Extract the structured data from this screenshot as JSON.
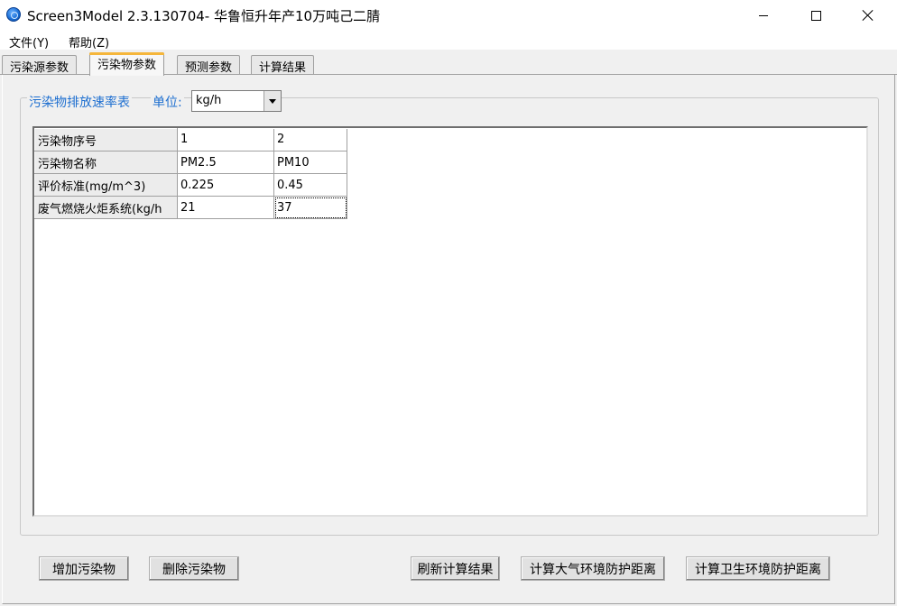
{
  "window": {
    "title": "Screen3Model 2.3.130704- 华鲁恒升年产10万吨己二腈",
    "icon": "app-globe-icon"
  },
  "menu": {
    "file": "文件(Y)",
    "help": "帮助(Z)"
  },
  "tabs": [
    {
      "label": "污染源参数",
      "active": false
    },
    {
      "label": "污染物参数",
      "active": true
    },
    {
      "label": "预测参数",
      "active": false
    },
    {
      "label": "计算结果",
      "active": false
    }
  ],
  "group": {
    "title": "污染物排放速率表",
    "unit_label": "单位:",
    "unit_value": "kg/h"
  },
  "grid": {
    "rows": [
      {
        "header": "污染物序号",
        "cells": [
          "1",
          "2"
        ]
      },
      {
        "header": "污染物名称",
        "cells": [
          "PM2.5",
          "PM10"
        ]
      },
      {
        "header": "评价标准(mg/m^3)",
        "cells": [
          "0.225",
          "0.45"
        ]
      },
      {
        "header": "废气燃烧火炬系统(kg/h",
        "cells": [
          "21",
          "37"
        ]
      }
    ]
  },
  "buttons": {
    "add": "增加污染物",
    "delete": "删除污染物",
    "refresh": "刷新计算结果",
    "atmos": "计算大气环境防护距离",
    "health": "计算卫生环境防护距离"
  },
  "colors": {
    "group_title": "#1e6fd0",
    "active_tab_accent": "#f5b63b"
  }
}
